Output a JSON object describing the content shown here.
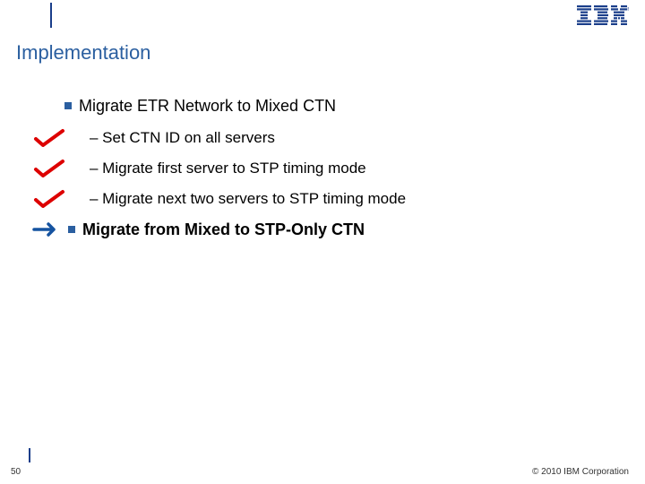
{
  "header": {
    "logo_alt": "IBM"
  },
  "title": "Implementation",
  "bullets": {
    "b1": "Migrate ETR Network to Mixed CTN",
    "s1": "– Set CTN ID on all servers",
    "s2": "– Migrate first server to STP timing mode",
    "s3": "– Migrate next two servers to STP timing mode",
    "b2": "Migrate from Mixed to STP-Only CTN"
  },
  "footer": {
    "page": "50",
    "copyright": "© 2010 IBM Corporation"
  }
}
